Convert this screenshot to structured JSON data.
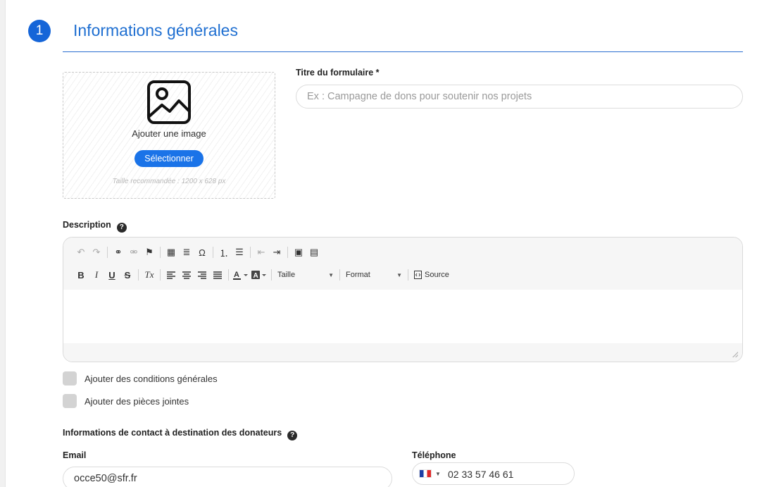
{
  "section": {
    "step_number": "1",
    "title": "Informations générales"
  },
  "image_upload": {
    "icon": "image-icon",
    "label": "Ajouter une image",
    "button_label": "Sélectionner",
    "hint": "Taille recommandée : 1200 x 628 px"
  },
  "form_title": {
    "label": "Titre du formulaire *",
    "placeholder": "Ex : Campagne de dons pour soutenir nos projets",
    "value": ""
  },
  "description": {
    "label": "Description",
    "help_icon": "question-circle-icon",
    "help_glyph": "?",
    "toolbar": {
      "row1": [
        {
          "name": "undo-icon",
          "glyph": "↶",
          "enabled": false
        },
        {
          "name": "redo-icon",
          "glyph": "↷",
          "enabled": false
        },
        {
          "name": "link-icon",
          "glyph": "⚭",
          "enabled": true
        },
        {
          "name": "unlink-icon",
          "glyph": "⚮",
          "enabled": false
        },
        {
          "name": "anchor-icon",
          "glyph": "⚑",
          "enabled": true
        },
        {
          "name": "table-icon",
          "glyph": "▦",
          "enabled": true
        },
        {
          "name": "horizontal-line-icon",
          "glyph": "≣",
          "enabled": true
        },
        {
          "name": "special-char-icon",
          "glyph": "Ω",
          "enabled": true
        },
        {
          "name": "numbered-list-icon",
          "glyph": "⒈",
          "enabled": true
        },
        {
          "name": "bulleted-list-icon",
          "glyph": "☰",
          "enabled": true
        },
        {
          "name": "outdent-icon",
          "glyph": "⇤",
          "enabled": false
        },
        {
          "name": "indent-icon",
          "glyph": "⇥",
          "enabled": true
        },
        {
          "name": "insert-image-icon",
          "glyph": "▣",
          "enabled": true
        },
        {
          "name": "template-icon",
          "glyph": "▤",
          "enabled": true
        }
      ],
      "row2": {
        "bold": "B",
        "italic": "I",
        "underline": "U",
        "strike": "S",
        "remove_format": "Tx",
        "size_label": "Taille",
        "format_label": "Format",
        "source_label": "Source"
      }
    }
  },
  "options": [
    {
      "label": "Ajouter des conditions générales",
      "checked": false
    },
    {
      "label": "Ajouter des pièces jointes",
      "checked": false
    }
  ],
  "contact": {
    "heading": "Informations de contact à destination des donateurs",
    "email_label": "Email",
    "email_value": "occe50@sfr.fr",
    "phone_label": "Téléphone",
    "phone_country": "france-flag-icon",
    "phone_value": "02 33 57 46 61"
  },
  "colors": {
    "accent": "#1a73e8",
    "title_blue": "#1f6fd1"
  }
}
